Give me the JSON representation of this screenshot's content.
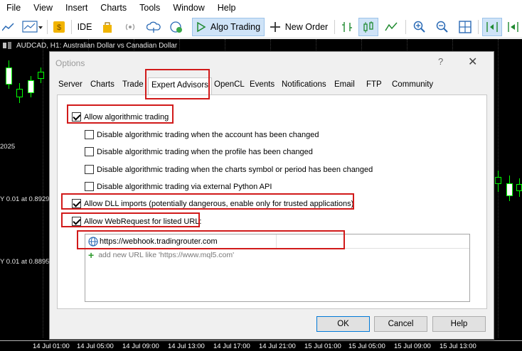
{
  "menu": [
    "File",
    "View",
    "Insert",
    "Charts",
    "Tools",
    "Window",
    "Help"
  ],
  "toolbar": {
    "ide_label": "IDE",
    "algo_trading_label": "Algo Trading",
    "new_order_label": "New Order"
  },
  "chart": {
    "title": "AUDCAD, H1:  Australian Dollar vs Canadian Dollar",
    "side_labels": [
      "2025",
      "Y 0.01 at 0.8929",
      "Y 0.01 at 0.8895"
    ],
    "time_labels": [
      "14 Jul 01:00",
      "14 Jul 05:00",
      "14 Jul 09:00",
      "14 Jul 13:00",
      "14 Jul 17:00",
      "14 Jul 21:00",
      "15 Jul 01:00",
      "15 Jul 05:00",
      "15 Jul 09:00",
      "15 Jul 13:00"
    ]
  },
  "dialog": {
    "title": "Options",
    "help_glyph": "?",
    "close_glyph": "✕",
    "tabs": [
      "Server",
      "Charts",
      "Trade",
      "Expert Advisors",
      "OpenCL",
      "Events",
      "Notifications",
      "Email",
      "FTP",
      "Community"
    ],
    "active_tab": "Expert Advisors",
    "options": {
      "allow_algo": {
        "label": "Allow algorithmic trading",
        "checked": true
      },
      "disable_account": {
        "label": "Disable algorithmic trading when the account has been changed",
        "checked": false
      },
      "disable_profile": {
        "label": "Disable algorithmic trading when the profile has been changed",
        "checked": false
      },
      "disable_symbol": {
        "label": "Disable algorithmic trading when the charts symbol or period has been changed",
        "checked": false
      },
      "disable_python": {
        "label": "Disable algorithmic trading via external Python API",
        "checked": false
      },
      "allow_dll": {
        "label": "Allow DLL imports (potentially dangerous, enable only for trusted applications)",
        "checked": true
      },
      "allow_webrequest": {
        "label": "Allow WebRequest for listed URL:",
        "checked": true
      }
    },
    "url_list": {
      "entry": "https://webhook.tradingrouter.com",
      "add_placeholder": "add new URL like 'https://www.mql5.com'"
    },
    "buttons": {
      "ok": "OK",
      "cancel": "Cancel",
      "help": "Help"
    }
  },
  "colors": {
    "highlight": "#d11a1a",
    "chart_bg": "#000000",
    "candle": "#00ff00",
    "dialog_bg": "#f0f0f0"
  }
}
